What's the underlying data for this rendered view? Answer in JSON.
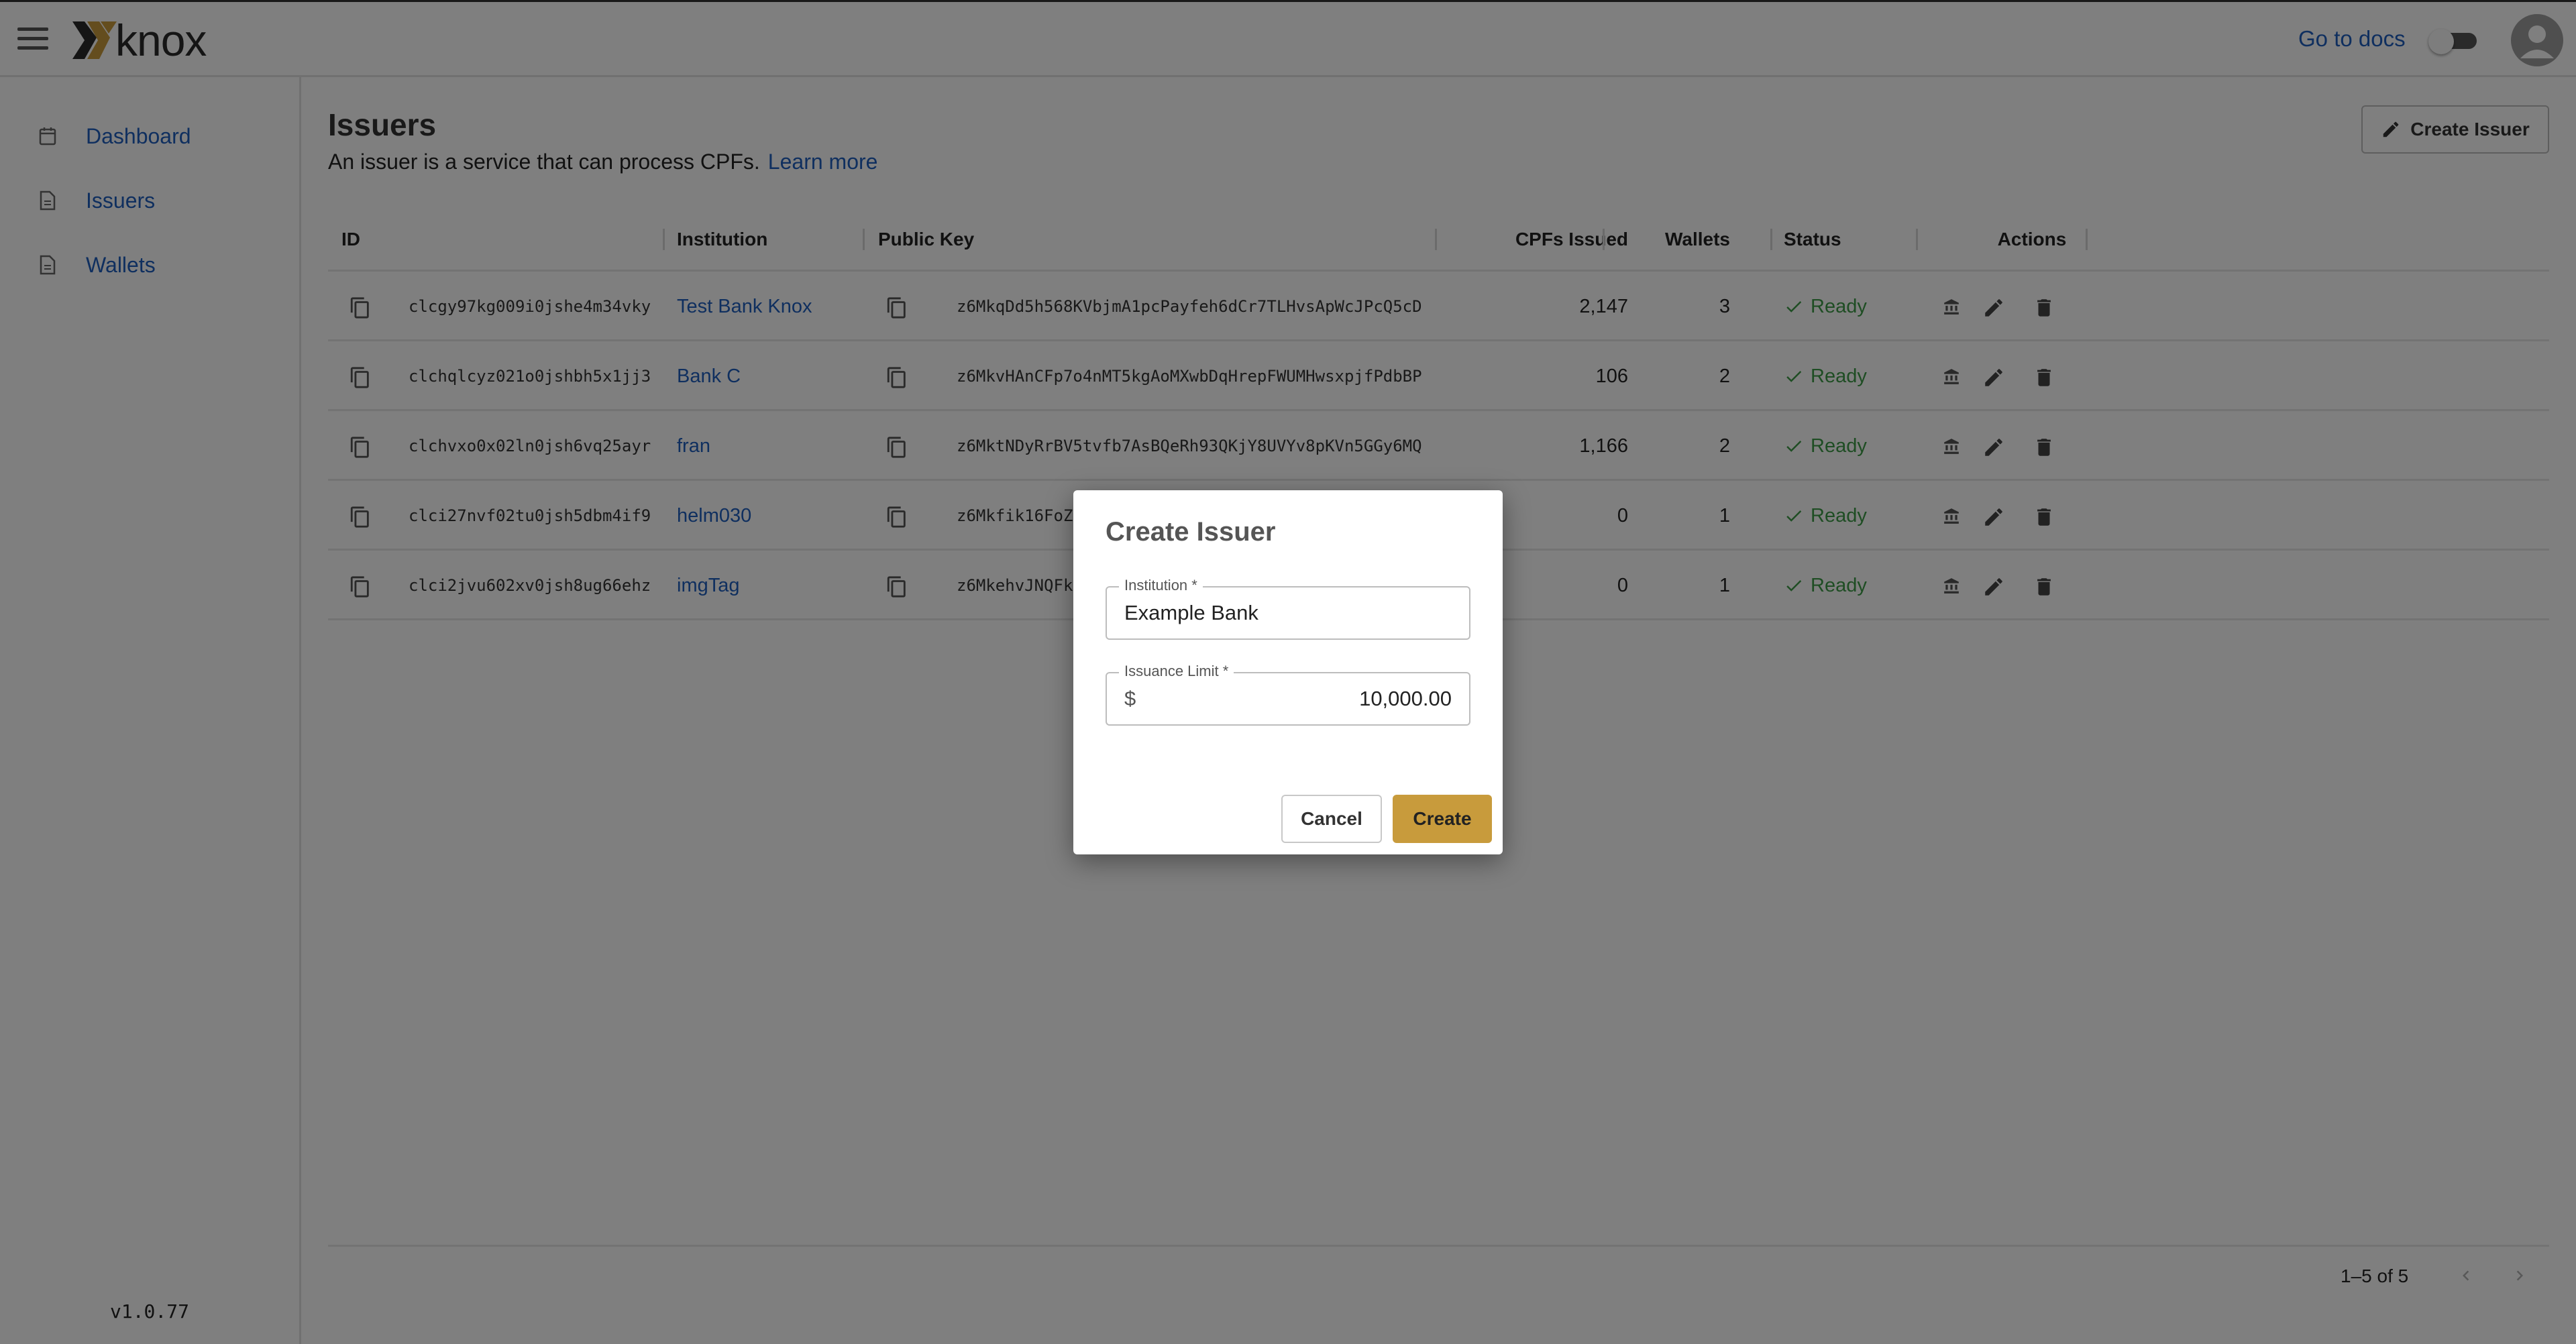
{
  "header": {
    "logo_text": "knox",
    "docs_link": "Go to docs"
  },
  "sidebar": {
    "items": [
      {
        "label": "Dashboard",
        "icon": "calendar-icon"
      },
      {
        "label": "Issuers",
        "icon": "document-icon"
      },
      {
        "label": "Wallets",
        "icon": "document-icon"
      }
    ],
    "version": "v1.0.77"
  },
  "main": {
    "title": "Issuers",
    "description": "An issuer is a service that can process CPFs.",
    "learn_more": "Learn more",
    "create_button": "Create Issuer"
  },
  "table": {
    "columns": {
      "id": "ID",
      "institution": "Institution",
      "public_key": "Public Key",
      "cpfs_issued": "CPFs Issued",
      "wallets": "Wallets",
      "status": "Status",
      "actions": "Actions"
    },
    "rows": [
      {
        "id": "clcgy97kg009i0jshe4m34vky",
        "institution": "Test Bank Knox",
        "public_key": "z6MkqDd5h568KVbjmA1pcPayfeh6dCr7TLHvsApWcJPcQ5cD",
        "cpfs_issued": "2,147",
        "wallets": "3",
        "status": "Ready"
      },
      {
        "id": "clchqlcyz021o0jshbh5x1jj3",
        "institution": "Bank C",
        "public_key": "z6MkvHAnCFp7o4nMT5kgAoMXwbDqHrepFWUMHwsxpjfPdbBP",
        "cpfs_issued": "106",
        "wallets": "2",
        "status": "Ready"
      },
      {
        "id": "clchvxo0x02ln0jsh6vq25ayr",
        "institution": "fran",
        "public_key": "z6MktNDyRrBV5tvfb7AsBQeRh93QKjY8UVYv8pKVn5GGy6MQ",
        "cpfs_issued": "1,166",
        "wallets": "2",
        "status": "Ready"
      },
      {
        "id": "clci27nvf02tu0jsh5dbm4if9",
        "institution": "helm030",
        "public_key": "z6Mkfik16FoZ",
        "cpfs_issued": "0",
        "wallets": "1",
        "status": "Ready"
      },
      {
        "id": "clci2jvu602xv0jsh8ug66ehz",
        "institution": "imgTag",
        "public_key": "z6MkehvJNQFk",
        "cpfs_issued": "0",
        "wallets": "1",
        "status": "Ready"
      }
    ],
    "pagination": "1–5 of 5"
  },
  "dialog": {
    "title": "Create Issuer",
    "institution_label": "Institution *",
    "institution_value": "Example Bank",
    "limit_label": "Issuance Limit *",
    "limit_prefix": "$",
    "limit_value": "10,000.00",
    "cancel_label": "Cancel",
    "create_label": "Create"
  },
  "colors": {
    "link": "#1f5fbf",
    "ready": "#3d9a47",
    "primary_button": "#c89b3c",
    "overlay": "rgba(0,0,0,0.5)"
  }
}
